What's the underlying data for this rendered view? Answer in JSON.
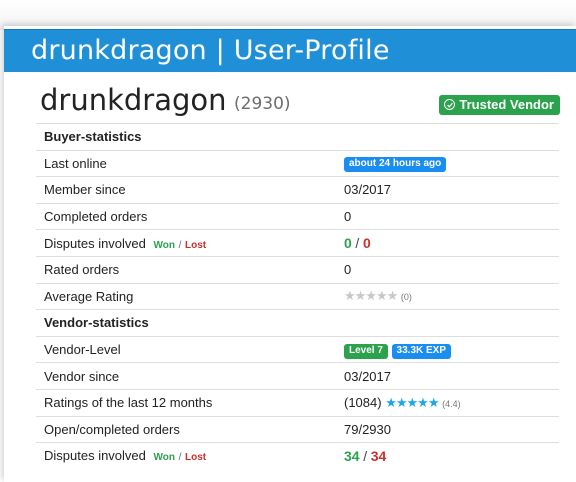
{
  "header": {
    "title": "drunkdragon | User-Profile"
  },
  "profile": {
    "username": "drunkdragon",
    "count": "(2930)",
    "trusted_badge": "Trusted Vendor",
    "trusted_icon": "check-circle-icon"
  },
  "buyer": {
    "heading": "Buyer-statistics",
    "last_online_label": "Last online",
    "last_online_value": "about 24 hours ago",
    "member_since_label": "Member since",
    "member_since_value": "03/2017",
    "completed_label": "Completed orders",
    "completed_value": "0",
    "disputes_label": "Disputes involved",
    "disputes_won_label": "Won",
    "disputes_sep": "/",
    "disputes_lost_label": "Lost",
    "disputes_won": "0",
    "disputes_lost": "0",
    "rated_label": "Rated orders",
    "rated_value": "0",
    "avg_label": "Average Rating",
    "avg_stars": 0,
    "avg_count": "(0)"
  },
  "vendor": {
    "heading": "Vendor-statistics",
    "level_label": "Vendor-Level",
    "level_badge": "Level 7",
    "exp_badge": "33.3K EXP",
    "since_label": "Vendor since",
    "since_value": "03/2017",
    "ratings_label": "Ratings of the last 12 months",
    "ratings_count": "(1084)",
    "ratings_stars": 5,
    "ratings_avg": "(4.4)",
    "orders_label": "Open/completed orders",
    "orders_value": "79/2930",
    "disputes_label": "Disputes involved",
    "disputes_won_label": "Won",
    "disputes_sep": "/",
    "disputes_lost_label": "Lost",
    "disputes_won": "34",
    "disputes_lost": "34"
  },
  "stars_glyph": "★★★★★",
  "colors": {
    "brand": "#1f8fd8",
    "success": "#2ba24c",
    "danger": "#c9302c",
    "info": "#1a8df0"
  }
}
